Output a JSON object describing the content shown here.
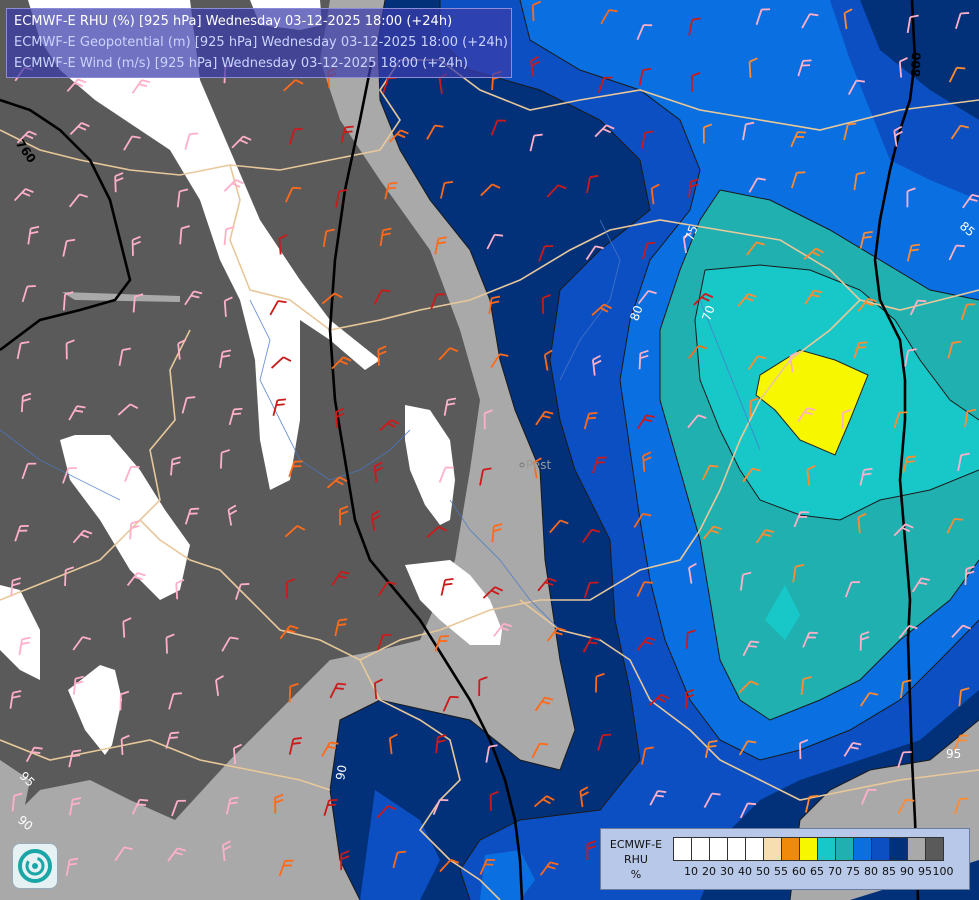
{
  "header": {
    "line1": "ECMWF-E RHU (%) [925 hPa] Wednesday 03-12-2025 18:00 (+24h)",
    "line2": "ECMWF-E Geopotential (m) [925 hPa] Wednesday 03-12-2025 18:00 (+24h)",
    "line3": "ECMWF-E Wind (m/s) [925 hPa] Wednesday 03-12-2025 18:00 (+24h)"
  },
  "map": {
    "city_label": "Pest",
    "geopotential_labels": [
      "760",
      "800",
      "800"
    ],
    "rhu_contour_labels": [
      "95",
      "95",
      "90",
      "90",
      "85",
      "80",
      "75",
      "70",
      "95",
      "70"
    ],
    "colors": {
      "white": "#ffffff",
      "grey_dark": "#5a5a5a",
      "grey_light": "#a9a9a9",
      "navy": "#02317a",
      "blue_mid": "#0b4fc2",
      "blue_bright": "#0a6fe0",
      "teal": "#20b0b0",
      "cyan": "#18c8c8",
      "yellow": "#f7f700",
      "border_line": "#e8c89a"
    }
  },
  "legend": {
    "title": "ECMWF-E\nRHU\n%",
    "swatch_colors": [
      "#ffffff",
      "#ffffff",
      "#ffffff",
      "#ffffff",
      "#ffffff",
      "#f6deb0",
      "#ef8a0a",
      "#f7f700",
      "#18c8c8",
      "#20b0b0",
      "#0a6fe0",
      "#0b4fc2",
      "#02317a",
      "#a9a9a9",
      "#5a5a5a"
    ],
    "ticks": [
      "10",
      "20",
      "30",
      "40",
      "50",
      "55",
      "60",
      "65",
      "70",
      "75",
      "80",
      "85",
      "90",
      "95",
      "100"
    ]
  },
  "logo_icon": "ecmwf-swirl-logo"
}
